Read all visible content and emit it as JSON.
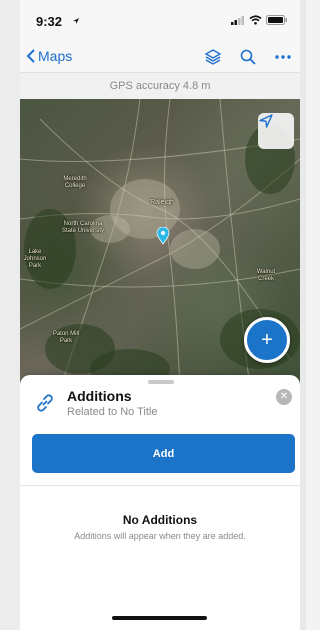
{
  "status": {
    "time": "9:32"
  },
  "nav": {
    "back_label": "Maps",
    "icons": [
      "layers-icon",
      "search-icon",
      "more-icon"
    ]
  },
  "accuracy": {
    "text": "GPS accuracy 4.8 m"
  },
  "map": {
    "labels": {
      "raleigh": "Raleigh",
      "ncsu": "North Carolina State University",
      "meredith": "Meredith College",
      "lake_johnson": "Lake Johnson Park",
      "paton": "Paton Mill Park",
      "walnut": "Walnut Creek"
    }
  },
  "sheet": {
    "title": "Additions",
    "subtitle": "Related to No Title",
    "add_label": "Add",
    "empty_title": "No Additions",
    "empty_subtitle": "Additions will appear when they are added."
  },
  "colors": {
    "accent": "#1c74c9",
    "pin": "#29b7e6"
  }
}
